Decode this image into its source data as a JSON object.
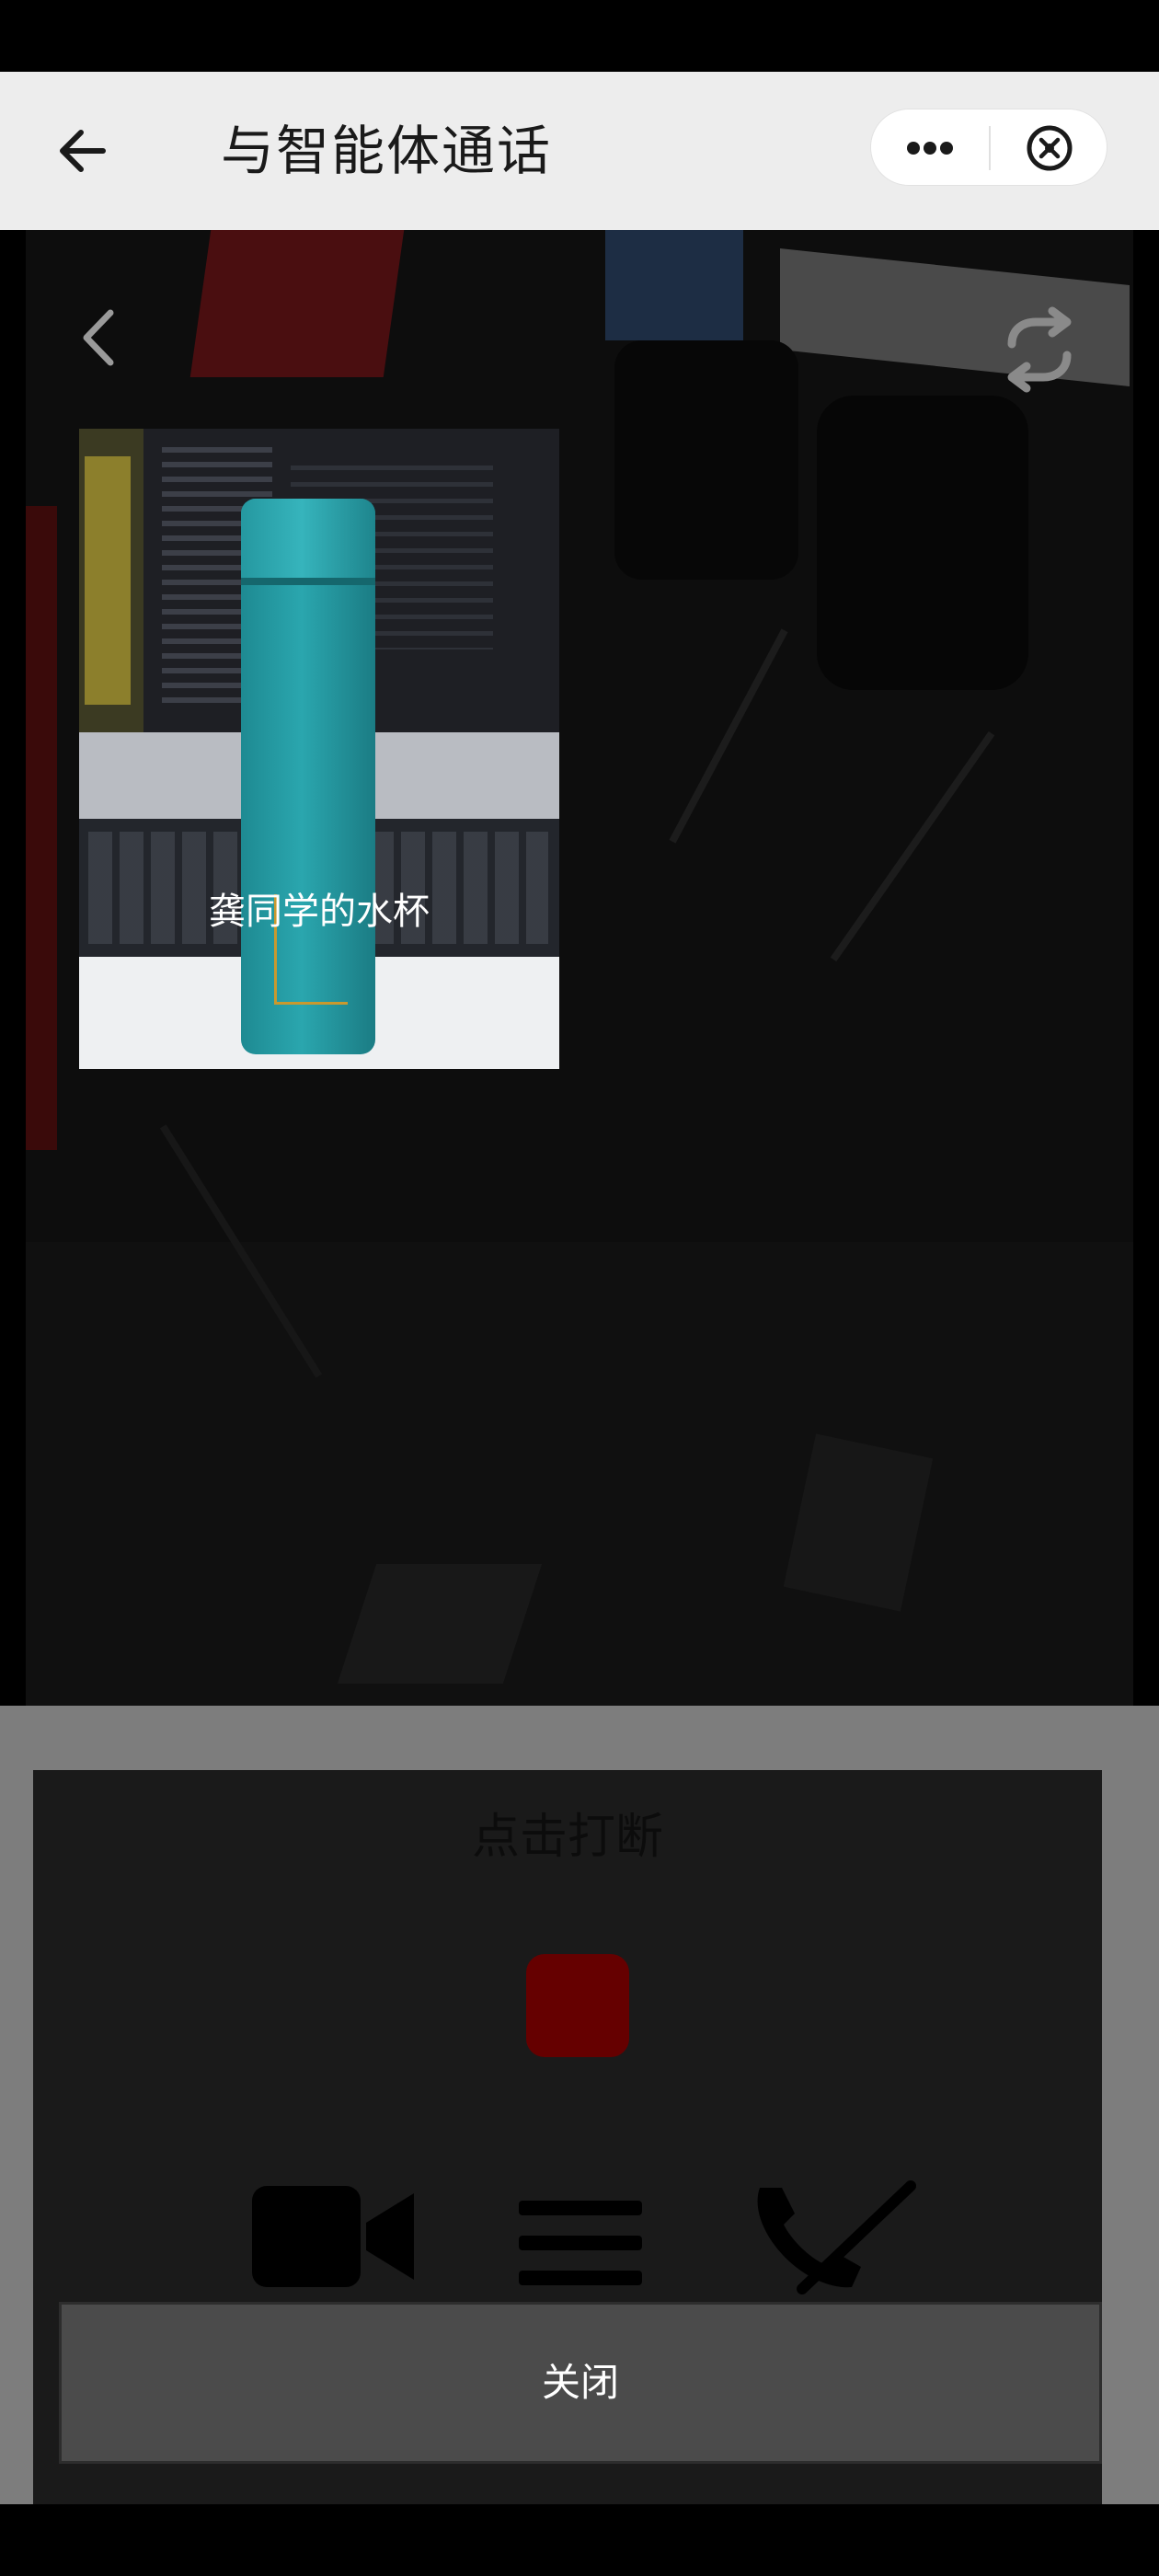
{
  "nav": {
    "title": "与智能体通话",
    "back_icon": "arrow-left-icon",
    "more_icon": "more-dots-icon",
    "close_icon": "circle-close-icon"
  },
  "camera": {
    "prev_icon": "chevron-left-icon",
    "switch_icon": "switch-camera-icon"
  },
  "recognition": {
    "object_label": "龚同学的水杯"
  },
  "controls": {
    "interrupt_hint": "点击打断",
    "stop_icon": "stop-square-icon",
    "camera_icon": "video-camera-icon",
    "menu_icon": "menu-icon",
    "hangup_icon": "hang-up-phone-icon"
  },
  "close_bar": {
    "label": "关闭"
  },
  "colors": {
    "nav_bg": "#ededed",
    "overlay_panel": "#1a1a1a",
    "stop_red": "#650000",
    "close_bar_bg": "#4b4b4b"
  }
}
